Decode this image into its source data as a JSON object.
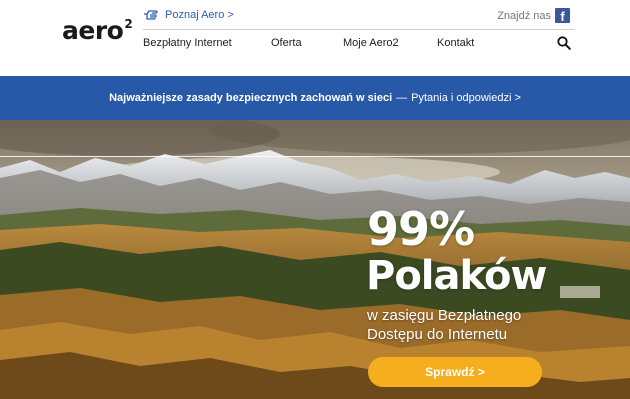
{
  "brand": {
    "logo_text": "aero",
    "logo_sup": "2"
  },
  "header": {
    "poznaj_label": "Poznaj Aero >",
    "facebook_label": "Znajdź nas",
    "facebook_icon": "f",
    "nav": [
      "Bezpłatny Internet",
      "Oferta",
      "Moje Aero2",
      "Kontakt"
    ],
    "search_icon": "search-icon"
  },
  "banner": {
    "bold_text": "Najważniejsze zasady bezpiecznych zachowań w sieci",
    "separator": "—",
    "link_text": "Pytania i odpowiedzi >"
  },
  "hero": {
    "headline_1": "99%",
    "headline_2": "Polaków",
    "subline_1": "w zasięgu Bezpłatnego",
    "subline_2": "Dostępu do Internetu",
    "cta_label": "Sprawdź >"
  },
  "colors": {
    "banner": "#2759a8",
    "cta": "#f6ae1f",
    "link": "#2a5db0",
    "facebook": "#3b5998"
  }
}
